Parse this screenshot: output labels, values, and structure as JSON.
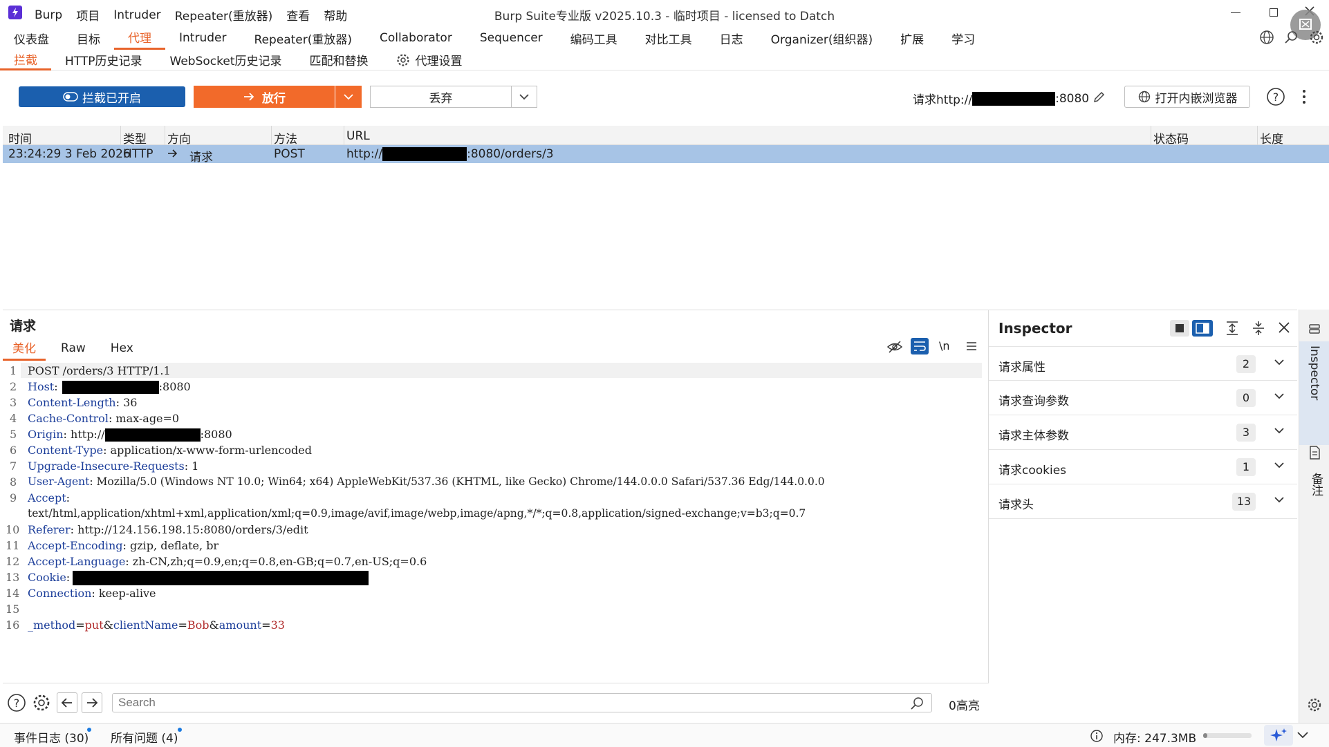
{
  "titlebar": {
    "menu": [
      "Burp",
      "项目",
      "Intruder",
      "Repeater(重放器)",
      "查看",
      "帮助"
    ],
    "title": "Burp Suite专业版  v2025.10.3 - 临时项目 - licensed to Datch"
  },
  "main_tabs": [
    "仪表盘",
    "目标",
    "代理",
    "Intruder",
    "Repeater(重放器)",
    "Collaborator",
    "Sequencer",
    "编码工具",
    "对比工具",
    "日志",
    "Organizer(组织器)",
    "扩展",
    "学习"
  ],
  "sub_tabs": [
    "拦截",
    "HTTP历史记录",
    "WebSocket历史记录",
    "匹配和替换"
  ],
  "proxy_settings_label": "代理设置",
  "toolbar": {
    "intercept_label": "拦截已开启",
    "forward_label": "放行",
    "drop_label": "丢弃",
    "request_prefix": "请求http://",
    "request_suffix": ":8080",
    "browser_label": "打开内嵌浏览器"
  },
  "table": {
    "headers": [
      "时间",
      "类型",
      "方向",
      "方法",
      "URL",
      "状态码",
      "长度"
    ],
    "row": {
      "time": "23:24:29 3 Feb 2026",
      "type": "HTTP",
      "direction": "请求",
      "method": "POST",
      "url_prefix": "http://",
      "url_suffix": ":8080/orders/3"
    }
  },
  "request": {
    "title": "请求",
    "tabs": [
      "美化",
      "Raw",
      "Hex"
    ],
    "newline_label": "\\n",
    "lines": {
      "l1": "POST /orders/3 HTTP/1.1",
      "l2k": "Host",
      "l2v": ":8080",
      "l3k": "Content-Length",
      "l3v": " 36",
      "l4k": "Cache-Control",
      "l4v": " max-age=0",
      "l5k": "Origin",
      "l5v_pre": " http://",
      "l5v_post": ":8080",
      "l6k": "Content-Type",
      "l6v": " application/x-www-form-urlencoded",
      "l7k": "Upgrade-Insecure-Requests",
      "l7v": " 1",
      "l8k": "User-Agent",
      "l8v": " Mozilla/5.0 (Windows NT 10.0; Win64; x64) AppleWebKit/537.36 (KHTML, like Gecko) Chrome/144.0.0.0 Safari/537.36 Edg/144.0.0.0",
      "l9k": "Accept",
      "l9v": "text/html,application/xhtml+xml,application/xml;q=0.9,image/avif,image/webp,image/apng,*/*;q=0.8,application/signed-exchange;v=b3;q=0.7",
      "l10k": "Referer",
      "l10v": " http://124.156.198.15:8080/orders/3/edit",
      "l11k": "Accept-Encoding",
      "l11v": " gzip, deflate, br",
      "l12k": "Accept-Language",
      "l12v": " zh-CN,zh;q=0.9,en;q=0.8,en-GB;q=0.7,en-US;q=0.6",
      "l13k": "Cookie",
      "l14k": "Connection",
      "l14v": " keep-alive",
      "b1k": "_method",
      "b1v": "put",
      "b2k": "clientName",
      "b2v": "Bob",
      "b3k": "amount",
      "b3v": "33"
    },
    "line_numbers": [
      "1",
      "2",
      "3",
      "4",
      "5",
      "6",
      "7",
      "8",
      "9",
      "10",
      "11",
      "12",
      "13",
      "14",
      "15",
      "16"
    ]
  },
  "search": {
    "placeholder": "Search",
    "highlights": "0高亮"
  },
  "inspector": {
    "title": "Inspector",
    "sections": [
      {
        "label": "请求属性",
        "count": "2"
      },
      {
        "label": "请求查询参数",
        "count": "0"
      },
      {
        "label": "请求主体参数",
        "count": "3"
      },
      {
        "label": "请求cookies",
        "count": "1"
      },
      {
        "label": "请求头",
        "count": "13"
      }
    ],
    "side_tab_inspector": "Inspector",
    "side_tab_notes": "备注"
  },
  "statusbar": {
    "event_log": "事件日志 (30)",
    "issues": "所有问题 (4)",
    "memory": "内存: 247.3MB"
  },
  "colors": {
    "accent": "#e8632a",
    "intercept_blue": "#1b5fae",
    "forward_orange": "#f26a2a",
    "row_selected": "#a7c4e6"
  }
}
